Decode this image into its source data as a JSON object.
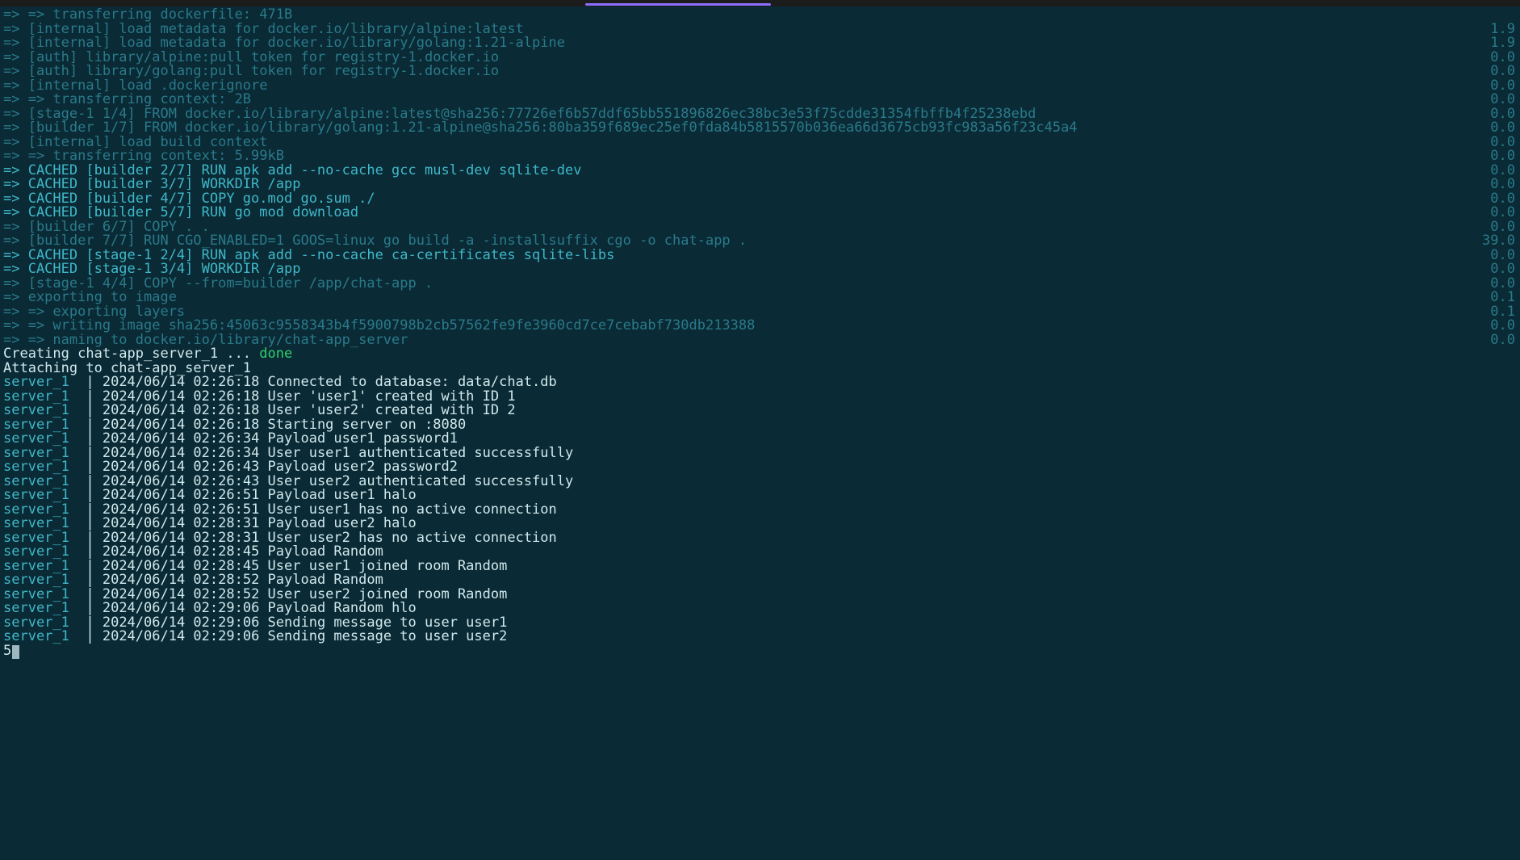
{
  "build_lines": [
    {
      "text": "=> => transferring dockerfile: 471B",
      "cls": "dim",
      "time": ""
    },
    {
      "text": "=> [internal] load metadata for docker.io/library/alpine:latest",
      "cls": "dim",
      "time": "1.9"
    },
    {
      "text": "=> [internal] load metadata for docker.io/library/golang:1.21-alpine",
      "cls": "dim",
      "time": "1.9"
    },
    {
      "text": "=> [auth] library/alpine:pull token for registry-1.docker.io",
      "cls": "dim",
      "time": "0.0"
    },
    {
      "text": "=> [auth] library/golang:pull token for registry-1.docker.io",
      "cls": "dim",
      "time": "0.0"
    },
    {
      "text": "=> [internal] load .dockerignore",
      "cls": "dim",
      "time": "0.0"
    },
    {
      "text": "=> => transferring context: 2B",
      "cls": "dim",
      "time": "0.0"
    },
    {
      "text": "=> [stage-1 1/4] FROM docker.io/library/alpine:latest@sha256:77726ef6b57ddf65bb551896826ec38bc3e53f75cdde31354fbffb4f25238ebd",
      "cls": "dim",
      "time": "0.0"
    },
    {
      "text": "=> [builder 1/7] FROM docker.io/library/golang:1.21-alpine@sha256:80ba359f689ec25ef0fda84b5815570b036ea66d3675cb93fc983a56f23c45a4",
      "cls": "dim",
      "time": "0.0"
    },
    {
      "text": "=> [internal] load build context",
      "cls": "dim",
      "time": "0.0"
    },
    {
      "text": "=> => transferring context: 5.99kB",
      "cls": "dim",
      "time": "0.0"
    },
    {
      "text": "=> CACHED [builder 2/7] RUN apk add --no-cache gcc musl-dev sqlite-dev",
      "cls": "cyan",
      "time": "0.0"
    },
    {
      "text": "=> CACHED [builder 3/7] WORKDIR /app",
      "cls": "cyan",
      "time": "0.0"
    },
    {
      "text": "=> CACHED [builder 4/7] COPY go.mod go.sum ./",
      "cls": "cyan",
      "time": "0.0"
    },
    {
      "text": "=> CACHED [builder 5/7] RUN go mod download",
      "cls": "cyan",
      "time": "0.0"
    },
    {
      "text": "=> [builder 6/7] COPY . .",
      "cls": "dim",
      "time": "0.0"
    },
    {
      "text": "=> [builder 7/7] RUN CGO_ENABLED=1 GOOS=linux go build -a -installsuffix cgo -o chat-app .",
      "cls": "dim",
      "time": "39.0"
    },
    {
      "text": "=> CACHED [stage-1 2/4] RUN apk add --no-cache ca-certificates sqlite-libs",
      "cls": "cyan",
      "time": "0.0"
    },
    {
      "text": "=> CACHED [stage-1 3/4] WORKDIR /app",
      "cls": "cyan",
      "time": "0.0"
    },
    {
      "text": "=> [stage-1 4/4] COPY --from=builder /app/chat-app .",
      "cls": "dim",
      "time": "0.0"
    },
    {
      "text": "=> exporting to image",
      "cls": "dim",
      "time": "0.1"
    },
    {
      "text": "=> => exporting layers",
      "cls": "dim",
      "time": "0.1"
    },
    {
      "text": "=> => writing image sha256:45063c9558343b4f5900798b2cb57562fe9fe3960cd7ce7cebabf730db213388",
      "cls": "dim",
      "time": "0.0"
    },
    {
      "text": "=> => naming to docker.io/library/chat-app_server",
      "cls": "dim",
      "time": "0.0"
    }
  ],
  "creating_prefix": "Creating chat-app_server_1 ... ",
  "creating_done": "done",
  "attaching": "Attaching to chat-app_server_1",
  "log_source": "server_1",
  "log_pipe": "  | ",
  "logs": [
    "2024/06/14 02:26:18 Connected to database: data/chat.db",
    "2024/06/14 02:26:18 User 'user1' created with ID 1",
    "2024/06/14 02:26:18 User 'user2' created with ID 2",
    "2024/06/14 02:26:18 Starting server on :8080",
    "2024/06/14 02:26:34 Payload user1 password1",
    "2024/06/14 02:26:34 User user1 authenticated successfully",
    "2024/06/14 02:26:43 Payload user2 password2",
    "2024/06/14 02:26:43 User user2 authenticated successfully",
    "2024/06/14 02:26:51 Payload user1 halo",
    "2024/06/14 02:26:51 User user1 has no active connection",
    "2024/06/14 02:28:31 Payload user2 halo",
    "2024/06/14 02:28:31 User user2 has no active connection",
    "2024/06/14 02:28:45 Payload Random",
    "2024/06/14 02:28:45 User user1 joined room Random",
    "2024/06/14 02:28:52 Payload Random",
    "2024/06/14 02:28:52 User user2 joined room Random",
    "2024/06/14 02:29:06 Payload Random hlo",
    "2024/06/14 02:29:06 Sending message to user user1",
    "2024/06/14 02:29:06 Sending message to user user2"
  ],
  "prompt_char": "5"
}
